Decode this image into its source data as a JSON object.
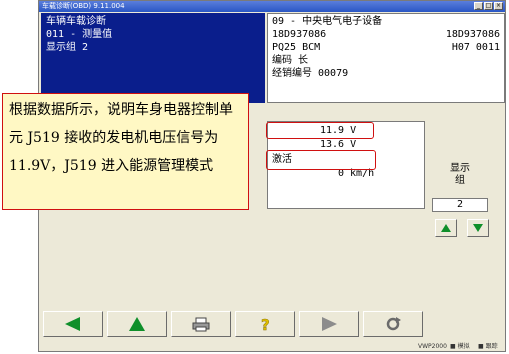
{
  "window": {
    "title": "车载诊断(OBD) 9.11.004",
    "buttons": [
      "_",
      "□",
      "×"
    ]
  },
  "left_panel": {
    "lines": [
      "车辆车载诊断",
      "011 - 测量值",
      "显示组 2"
    ]
  },
  "info_panel": {
    "line1": "09 - 中央电气电子设备",
    "part_number": "18D937086",
    "part_number_right": "18D937086",
    "component": "PQ25 BCM",
    "version": "H07  0011",
    "coding": "编码 长",
    "dealer": "经销编号 00079"
  },
  "measurements": {
    "row1": "11.9 V",
    "row2": "13.6 V",
    "row3": "激活",
    "row4": "0 km/h"
  },
  "display_group": {
    "label_line1": "显示",
    "label_line2": "组",
    "value": "2"
  },
  "statusbar": {
    "item1": "VWP2000",
    "item2": "模拟",
    "item3": "跟踪"
  },
  "annotation": {
    "text": "根据数据所示，说明车身电器控制单元 J519 接收的发电机电压信号为 11.9V，J519 进入能源管理模式"
  },
  "colors": {
    "panel_blue": "#0a1e8c",
    "highlight_red": "#d01010",
    "arrow_green": "#0f8f2a",
    "window_bg": "#ece9d8"
  },
  "toolbar": {
    "icons": [
      "back-arrow-icon",
      "up-arrow-icon",
      "printer-icon",
      "help-icon",
      "forward-arrow-icon",
      "refresh-icon"
    ]
  }
}
